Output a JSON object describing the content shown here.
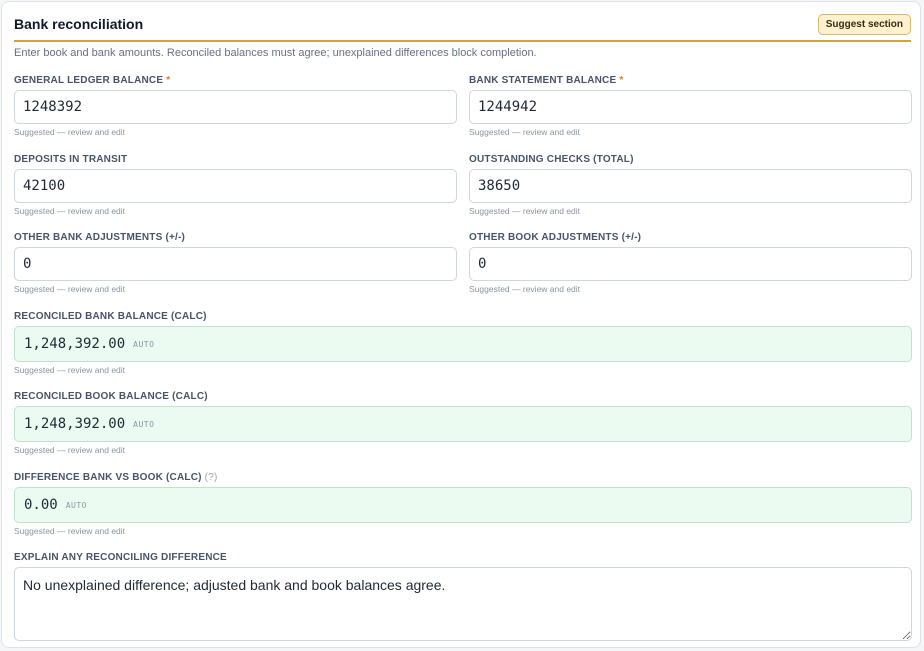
{
  "section": {
    "title": "Bank reconciliation",
    "suggest_label": "Suggest section",
    "description": "Enter book and bank amounts. Reconciled balances must agree; unexplained differences block completion."
  },
  "fields": {
    "gl_balance": {
      "label": "GENERAL LEDGER BALANCE",
      "value": "1248392",
      "required": "*",
      "hint": "Suggested — review and edit"
    },
    "bank_balance": {
      "label": "BANK STATEMENT BALANCE",
      "value": "1244942",
      "required": "*",
      "hint": "Suggested — review and edit"
    },
    "deposits_in_transit": {
      "label": "DEPOSITS IN TRANSIT",
      "value": "42100",
      "hint": "Suggested — review and edit"
    },
    "outstanding_checks": {
      "label": "OUTSTANDING CHECKS (TOTAL)",
      "value": "38650",
      "hint": "Suggested — review and edit"
    },
    "other_bank_adj": {
      "label": "OTHER BANK ADJUSTMENTS (+/-)",
      "value": "0",
      "hint": "Suggested — review and edit"
    },
    "other_book_adj": {
      "label": "OTHER BOOK ADJUSTMENTS (+/-)",
      "value": "0",
      "hint": "Suggested — review and edit"
    },
    "reconciled_bank": {
      "label": "RECONCILED BANK BALANCE (CALC)",
      "value": "1,248,392.00",
      "badge": "AUTO",
      "hint": "Suggested — review and edit"
    },
    "reconciled_book": {
      "label": "RECONCILED BOOK BALANCE (CALC)",
      "value": "1,248,392.00",
      "badge": "AUTO",
      "hint": "Suggested — review and edit"
    },
    "difference": {
      "label": "DIFFERENCE BANK VS BOOK (CALC)",
      "help": "(?)",
      "value": "0.00",
      "badge": "AUTO",
      "hint": "Suggested — review and edit"
    },
    "explanation": {
      "label": "EXPLAIN ANY RECONCILING DIFFERENCE",
      "value": "No unexplained difference; adjusted bank and book balances agree."
    }
  },
  "colors": {
    "accent": "#d4a23a",
    "calc_bg": "#ecfbf1",
    "calc_border": "#b9e8c9",
    "required": "#e07a2f"
  }
}
